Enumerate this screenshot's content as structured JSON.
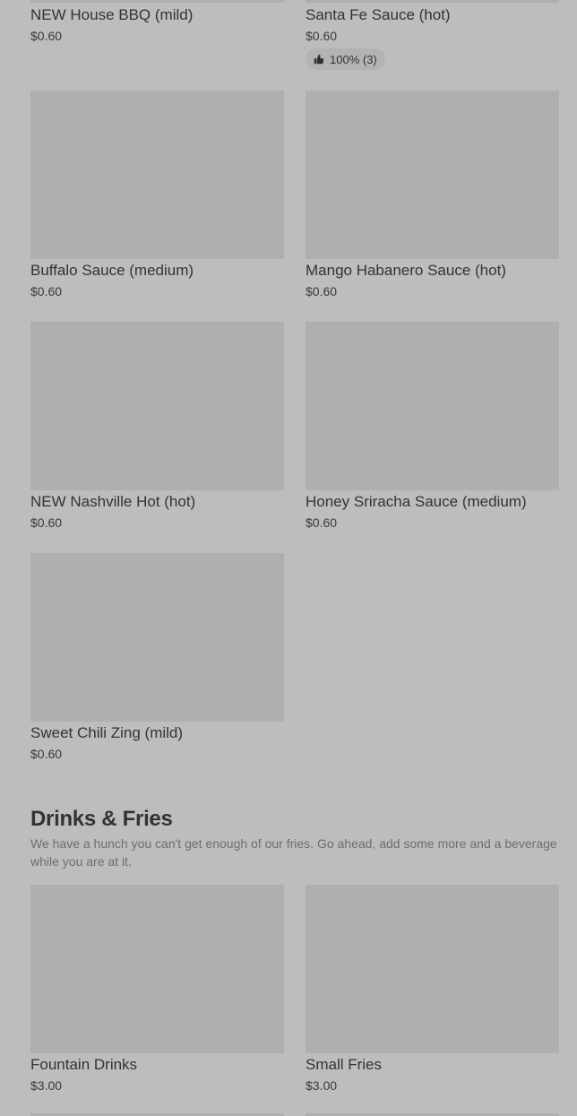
{
  "sauces": [
    {
      "name": "NEW House BBQ (mild)",
      "price": "$0.60"
    },
    {
      "name": "Santa Fe Sauce (hot)",
      "price": "$0.60",
      "rating": "100% (3)"
    },
    {
      "name": "Buffalo Sauce (medium)",
      "price": "$0.60"
    },
    {
      "name": "Mango Habanero Sauce (hot)",
      "price": "$0.60"
    },
    {
      "name": "NEW Nashville Hot (hot)",
      "price": "$0.60"
    },
    {
      "name": "Honey Sriracha Sauce (medium)",
      "price": "$0.60"
    },
    {
      "name": "Sweet Chili Zing (mild)",
      "price": "$0.60"
    }
  ],
  "drinks_section": {
    "title": "Drinks & Fries",
    "description": "We have a hunch you can't get enough of our fries. Go ahead, add some more and a beverage while you are at it.",
    "items": [
      {
        "name": "Fountain Drinks",
        "price": "$3.00"
      },
      {
        "name": "Small Fries",
        "price": "$3.00"
      }
    ]
  },
  "icons": {
    "rating": "thumbs-up-icon"
  },
  "colors": {
    "background": "#bdbdbd",
    "image_placeholder": "#afafaf"
  }
}
